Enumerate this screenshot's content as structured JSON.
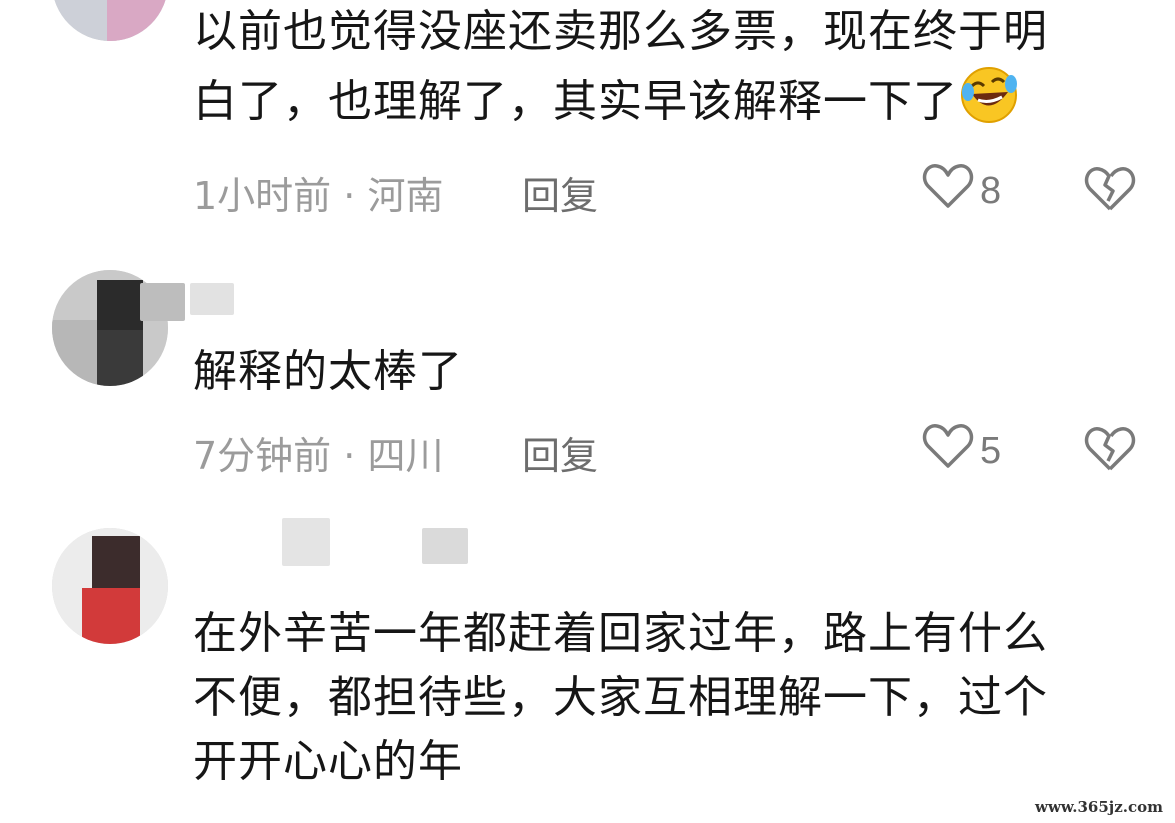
{
  "comments": [
    {
      "text_lines": [
        "以前也觉得没座还卖那么多票，现在终于明",
        "白了，也理解了，其实早该解释一下了"
      ],
      "emoji": "rolling-laughing-emoji",
      "time": "1小时前",
      "location": "河南",
      "separator": "·",
      "reply_label": "回复",
      "likes": "8"
    },
    {
      "text_lines": [
        "解释的太棒了"
      ],
      "time": "7分钟前",
      "location": "四川",
      "separator": "·",
      "reply_label": "回复",
      "likes": "5"
    },
    {
      "text_lines": [
        "在外辛苦一年都赶着回家过年，路上有什么",
        "不便，都担待些，大家互相理解一下，过个",
        "开开心心的年"
      ]
    }
  ],
  "watermark": "www.365jz.com",
  "icons": {
    "like": "heart-outline-icon",
    "dislike": "broken-heart-icon"
  },
  "colors": {
    "text": "#161616",
    "meta": "#9b9b9b",
    "icon": "#7a7a7a"
  }
}
